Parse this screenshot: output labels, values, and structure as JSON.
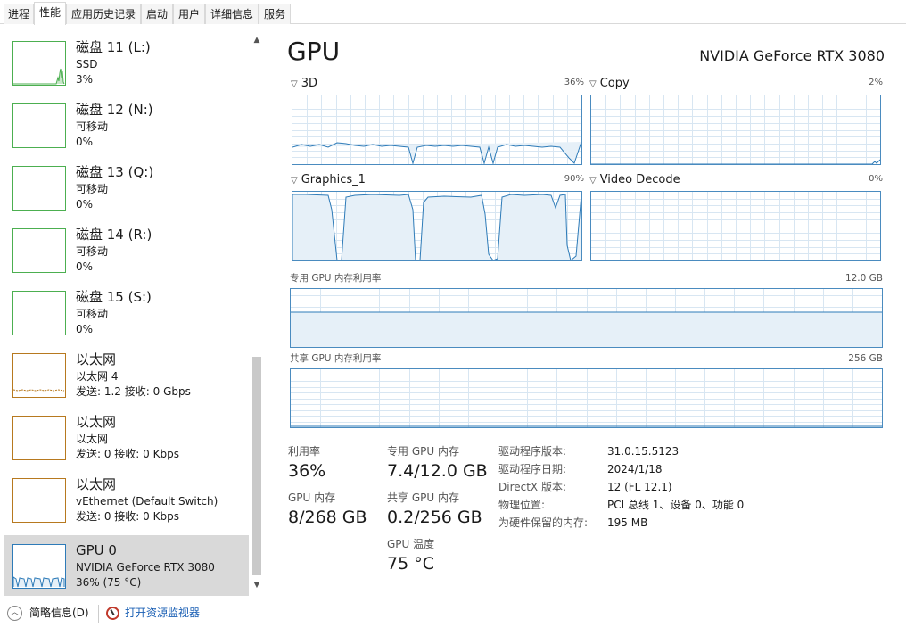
{
  "tabs": [
    {
      "label": "进程"
    },
    {
      "label": "性能"
    },
    {
      "label": "应用历史记录"
    },
    {
      "label": "启动"
    },
    {
      "label": "用户"
    },
    {
      "label": "详细信息"
    },
    {
      "label": "服务"
    }
  ],
  "sidebar": {
    "items": [
      {
        "title": "磁盘 11 (L:)",
        "sub1": "SSD",
        "sub2": "3%",
        "color": "#4caf50"
      },
      {
        "title": "磁盘 12 (N:)",
        "sub1": "可移动",
        "sub2": "0%",
        "color": "#4caf50"
      },
      {
        "title": "磁盘 13 (Q:)",
        "sub1": "可移动",
        "sub2": "0%",
        "color": "#4caf50"
      },
      {
        "title": "磁盘 14 (R:)",
        "sub1": "可移动",
        "sub2": "0%",
        "color": "#4caf50"
      },
      {
        "title": "磁盘 15 (S:)",
        "sub1": "可移动",
        "sub2": "0%",
        "color": "#4caf50"
      },
      {
        "title": "以太网",
        "sub1": "以太网 4",
        "sub2": "发送: 1.2 接收: 0 Gbps",
        "color": "#b7791f"
      },
      {
        "title": "以太网",
        "sub1": "以太网",
        "sub2": "发送: 0 接收: 0 Kbps",
        "color": "#b7791f"
      },
      {
        "title": "以太网",
        "sub1": "vEthernet (Default Switch)",
        "sub2": "发送: 0 接收: 0 Kbps",
        "color": "#b7791f"
      },
      {
        "title": "GPU 0",
        "sub1": "NVIDIA GeForce RTX 3080",
        "sub2": "36% (75 °C)",
        "color": "#2e7bb8"
      }
    ]
  },
  "main": {
    "title": "GPU",
    "device_name": "NVIDIA GeForce RTX 3080",
    "engines": [
      {
        "label": "3D",
        "percent": "36%"
      },
      {
        "label": "Copy",
        "percent": "2%"
      },
      {
        "label": "Graphics_1",
        "percent": "90%"
      },
      {
        "label": "Video Decode",
        "percent": "0%"
      }
    ],
    "dedicated_mem": {
      "label": "专用 GPU 内存利用率",
      "max": "12.0 GB"
    },
    "shared_mem": {
      "label": "共享 GPU 内存利用率",
      "max": "256 GB"
    },
    "stats": {
      "utilization_label": "利用率",
      "utilization_value": "36%",
      "dedicated_label": "专用 GPU 内存",
      "dedicated_value": "7.4/12.0 GB",
      "gpu_mem_label": "GPU 内存",
      "gpu_mem_value": "8/268 GB",
      "shared_label": "共享 GPU 内存",
      "shared_value": "0.2/256 GB",
      "temp_label": "GPU 温度",
      "temp_value": "75 °C"
    },
    "details": [
      {
        "key": "驱动程序版本:",
        "value": "31.0.15.5123"
      },
      {
        "key": "驱动程序日期:",
        "value": "2024/1/18"
      },
      {
        "key": "DirectX 版本:",
        "value": "12 (FL 12.1)"
      },
      {
        "key": "物理位置:",
        "value": "PCI 总线 1、设备 0、功能 0"
      },
      {
        "key": "为硬件保留的内存:",
        "value": "195 MB"
      }
    ]
  },
  "footer": {
    "less_details": "简略信息(D)",
    "resource_monitor": "打开资源监视器"
  },
  "colors": {
    "graph_line": "#2e7bb8",
    "graph_fill": "#e6f0f8",
    "grid": "#d8e6f2",
    "link": "#1a5fb4"
  }
}
